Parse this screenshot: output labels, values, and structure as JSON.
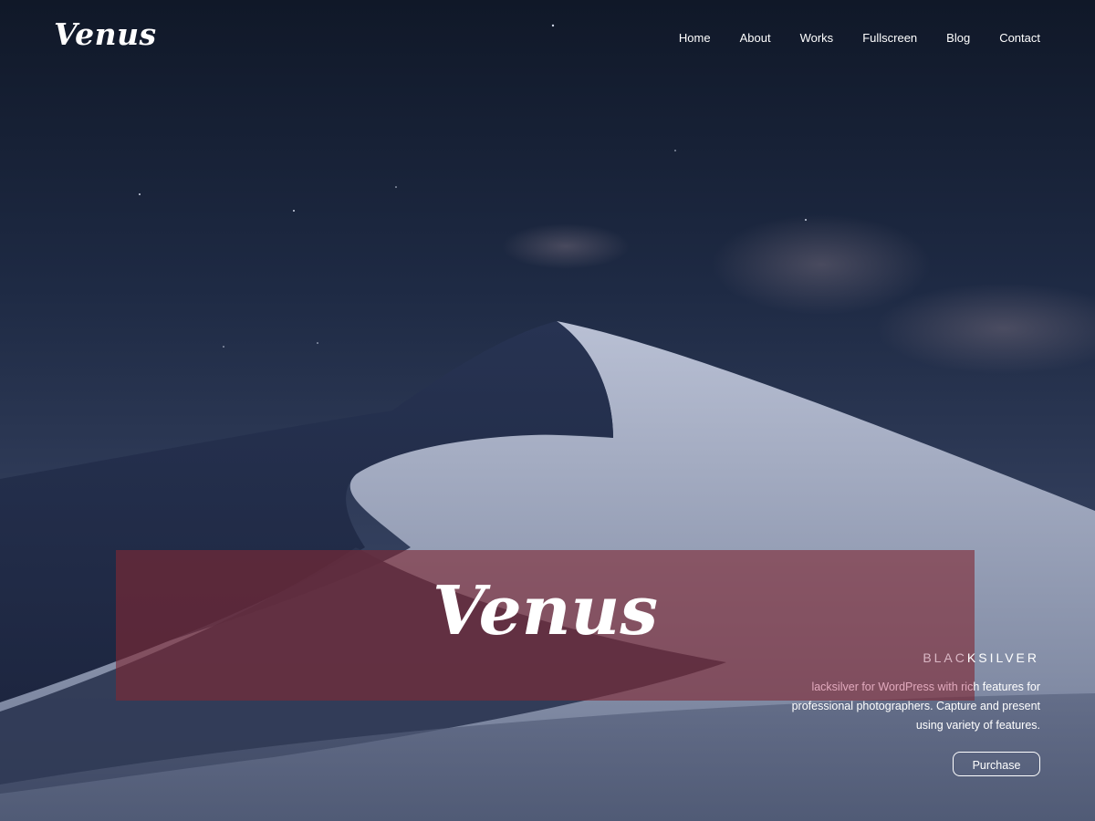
{
  "header": {
    "logo": "Venus",
    "nav": [
      "Home",
      "About",
      "Works",
      "Fullscreen",
      "Blog",
      "Contact"
    ]
  },
  "hero": {
    "title": "Venus",
    "brand_dim": "BLAC",
    "brand_rest": "KSILVER",
    "description_dim": "lacksilver for WordPress with ric",
    "description_rest": "h features for professional photographers. Capture and present using variety of features.",
    "button_label": "Purchase"
  },
  "colors": {
    "sky_top": "#121a2b",
    "hero_box": "#802834",
    "text": "#ffffff"
  }
}
